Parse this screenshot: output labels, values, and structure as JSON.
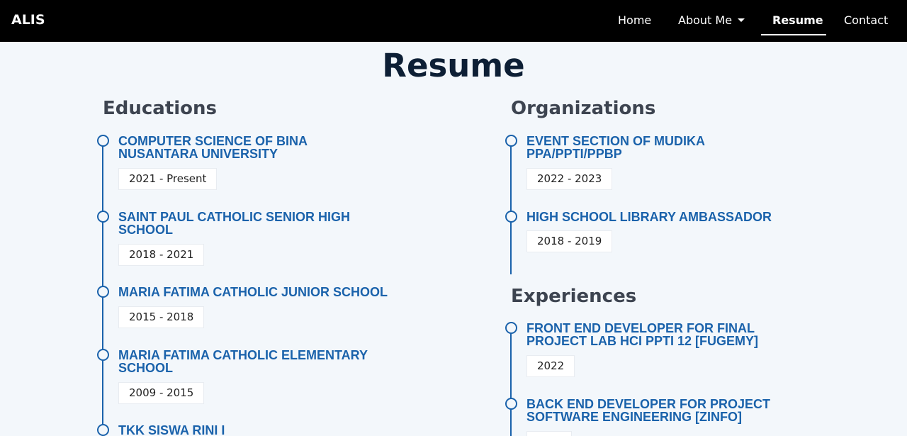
{
  "nav": {
    "brand": "ALIS",
    "items": [
      {
        "label": "Home"
      },
      {
        "label": "About Me"
      },
      {
        "label": "Resume"
      },
      {
        "label": "Contact"
      }
    ]
  },
  "page": {
    "title": "Resume"
  },
  "educations": {
    "title": "Educations",
    "items": [
      {
        "title": "COMPUTER SCIENCE OF BINA\nNUSANTARA UNIVERSITY",
        "date": "2021 - Present"
      },
      {
        "title": "SAINT PAUL CATHOLIC SENIOR HIGH\nSCHOOL",
        "date": "2018 - 2021"
      },
      {
        "title": "MARIA FATIMA CATHOLIC JUNIOR SCHOOL",
        "date": "2015 - 2018"
      },
      {
        "title": "MARIA FATIMA CATHOLIC ELEMENTARY\nSCHOOL",
        "date": "2009 - 2015"
      },
      {
        "title": "TKK SISWA RINI I"
      }
    ]
  },
  "organizations": {
    "title": "Organizations",
    "items": [
      {
        "title": "EVENT SECTION OF MUDIKA\nPPA/PPTI/PPBP",
        "date": "2022 - 2023"
      },
      {
        "title": "HIGH SCHOOL LIBRARY AMBASSADOR",
        "date": "2018 - 2019"
      }
    ]
  },
  "experiences": {
    "title": "Experiences",
    "items": [
      {
        "title": "FRONT END DEVELOPER FOR FINAL\nPROJECT LAB HCI PPTI 12 [FUGEMY]",
        "date": "2022"
      },
      {
        "title": "BACK END DEVELOPER FOR PROJECT\nSOFTWARE ENGINEERING [ZINFO]"
      }
    ]
  },
  "colors": {
    "navbar": "#000000",
    "background": "#f3f7fb",
    "accent": "#1a62ab",
    "heading": "#3d4450",
    "title": "#0d1f35"
  }
}
